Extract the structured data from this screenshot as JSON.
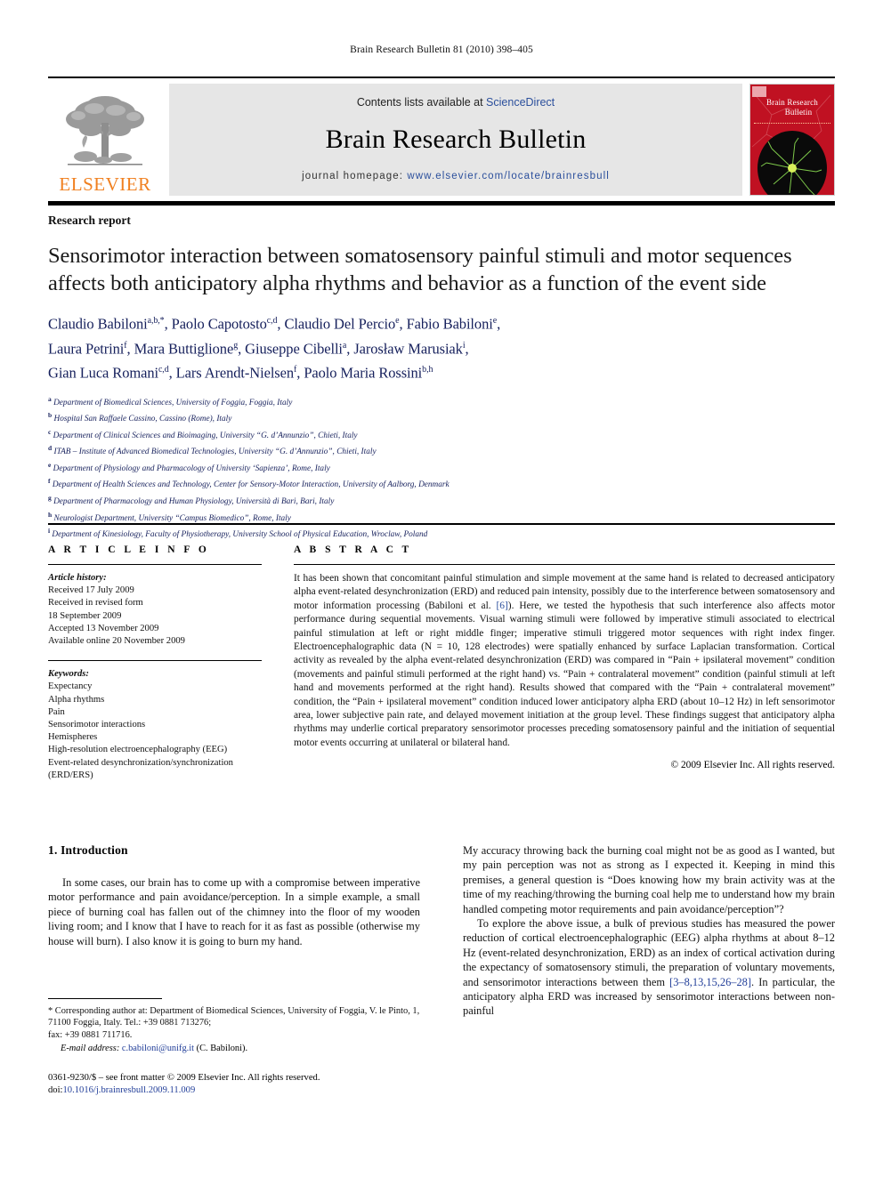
{
  "running_head": "Brain Research Bulletin 81 (2010) 398–405",
  "masthead": {
    "contents_prefix": "Contents lists available at ",
    "sciencedirect": "ScienceDirect",
    "journal_name": "Brain Research Bulletin",
    "homepage_prefix": "journal homepage: ",
    "homepage_url": "www.elsevier.com/locate/brainresbull",
    "publisher": "ELSEVIER",
    "cover": {
      "line1": "Brain Research",
      "line2": "Bulletin"
    },
    "colors": {
      "elsevier_orange": "#f08020",
      "link_blue": "#2b4f9c",
      "panel_gray": "#e6e6e6",
      "cover_red": "#c01122"
    }
  },
  "article": {
    "kind": "Research report",
    "title": "Sensorimotor interaction between somatosensory painful stimuli and motor sequences affects both anticipatory alpha rhythms and behavior as a function of the event side",
    "authors_lines": [
      [
        {
          "name": "Claudio Babiloni",
          "sup": "a,b,*"
        },
        {
          "name": "Paolo Capotosto",
          "sup": "c,d"
        },
        {
          "name": "Claudio Del Percio",
          "sup": "e"
        },
        {
          "name": "Fabio Babiloni",
          "sup": "e"
        }
      ],
      [
        {
          "name": "Laura Petrini",
          "sup": "f"
        },
        {
          "name": "Mara Buttiglione",
          "sup": "g"
        },
        {
          "name": "Giuseppe Cibelli",
          "sup": "a"
        },
        {
          "name": "Jarosław Marusiak",
          "sup": "i"
        }
      ],
      [
        {
          "name": "Gian Luca Romani",
          "sup": "c,d"
        },
        {
          "name": "Lars Arendt-Nielsen",
          "sup": "f"
        },
        {
          "name": "Paolo Maria Rossini",
          "sup": "b,h"
        }
      ]
    ],
    "affiliations": [
      {
        "mark": "a",
        "text": "Department of Biomedical Sciences, University of Foggia, Foggia, Italy"
      },
      {
        "mark": "b",
        "text": "Hospital San Raffaele Cassino, Cassino (Rome), Italy"
      },
      {
        "mark": "c",
        "text": "Department of Clinical Sciences and Bioimaging, University “G. d’Annunzio”, Chieti, Italy"
      },
      {
        "mark": "d",
        "text": "ITAB – Institute of Advanced Biomedical Technologies, University “G. d’Annunzio”, Chieti, Italy"
      },
      {
        "mark": "e",
        "text": "Department of Physiology and Pharmacology of University ‘Sapienza’, Rome, Italy"
      },
      {
        "mark": "f",
        "text": "Department of Health Sciences and Technology, Center for Sensory-Motor Interaction, University of Aalborg, Denmark"
      },
      {
        "mark": "g",
        "text": "Department of Pharmacology and Human Physiology, Università di Bari, Bari, Italy"
      },
      {
        "mark": "h",
        "text": "Neurologist Department, University “Campus Biomedico”, Rome, Italy"
      },
      {
        "mark": "i",
        "text": "Department of Kinesiology, Faculty of Physiotherapy, University School of Physical Education, Wroclaw, Poland"
      }
    ]
  },
  "article_info": {
    "heading": "A R T I C L E   I N F O",
    "history_label": "Article history:",
    "history": [
      "Received 17 July 2009",
      "Received in revised form",
      "18 September 2009",
      "Accepted 13 November 2009",
      "Available online 20 November 2009"
    ],
    "keywords_label": "Keywords:",
    "keywords": [
      "Expectancy",
      "Alpha rhythms",
      "Pain",
      "Sensorimotor interactions",
      "Hemispheres",
      "High-resolution electroencephalography (EEG)",
      "Event-related desynchronization/synchronization (ERD/ERS)"
    ]
  },
  "abstract": {
    "heading": "A B S T R A C T",
    "part1": "It has been shown that concomitant painful stimulation and simple movement at the same hand is related to decreased anticipatory alpha event-related desynchronization (ERD) and reduced pain intensity, possibly due to the interference between somatosensory and motor information processing (Babiloni et al. ",
    "citation": "[6]",
    "part2": "). Here, we tested the hypothesis that such interference also affects motor performance during sequential movements. Visual warning stimuli were followed by imperative stimuli associated to electrical painful stimulation at left or right middle finger; imperative stimuli triggered motor sequences with right index finger. Electroencephalographic data (N = 10, 128 electrodes) were spatially enhanced by surface Laplacian transformation. Cortical activity as revealed by the alpha event-related desynchronization (ERD) was compared in “Pain + ipsilateral movement” condition (movements and painful stimuli performed at the right hand) vs. “Pain + contralateral movement” condition (painful stimuli at left hand and movements performed at the right hand). Results showed that compared with the “Pain + contralateral movement” condition, the “Pain + ipsilateral movement” condition induced lower anticipatory alpha ERD (about 10–12 Hz) in left sensorimotor area, lower subjective pain rate, and delayed movement initiation at the group level. These findings suggest that anticipatory alpha rhythms may underlie cortical preparatory sensorimotor processes preceding somatosensory painful and the initiation of sequential motor events occurring at unilateral or bilateral hand.",
    "copyright": "© 2009 Elsevier Inc. All rights reserved."
  },
  "introduction": {
    "heading": "1.  Introduction",
    "left_paragraph": "In some cases, our brain has to come up with a compromise between imperative motor performance and pain avoidance/perception. In a simple example, a small piece of burning coal has fallen out of the chimney into the floor of my wooden living room; and I know that I have to reach for it as fast as possible (otherwise my house will burn). I also know it is going to burn my hand.",
    "right_paragraph_1": "My accuracy throwing back the burning coal might not be as good as I wanted, but my pain perception was not as strong as I expected it. Keeping in mind this premises, a general question is “Does knowing how my brain activity was at the time of my reaching/throwing the burning coal help me to understand how my brain handled competing motor requirements and pain avoidance/perception”?",
    "right_paragraph_2a": "To explore the above issue, a bulk of previous studies has measured the power reduction of cortical electroencephalographic (EEG) alpha rhythms at about 8–12 Hz (event-related desynchronization, ERD) as an index of cortical activation during the expectancy of somatosensory stimuli, the preparation of voluntary movements, and sensorimotor interactions between them ",
    "right_citation": "[3–8,13,15,26–28]",
    "right_paragraph_2b": ". In particular, the anticipatory alpha ERD was increased by sensorimotor interactions between non-painful"
  },
  "footnote": {
    "corresponding": "* Corresponding author at: Department of Biomedical Sciences, University of Foggia, V. le Pinto, 1, 71100 Foggia, Italy. Tel.: +39 0881 713276;",
    "fax": "fax: +39 0881 711716.",
    "email_label": "E-mail address:",
    "email": "c.babiloni@unifg.it",
    "email_suffix": "(C. Babiloni).",
    "issn_line": "0361-9230/$ – see front matter © 2009 Elsevier Inc. All rights reserved.",
    "doi_label": "doi:",
    "doi": "10.1016/j.brainresbull.2009.11.009"
  }
}
